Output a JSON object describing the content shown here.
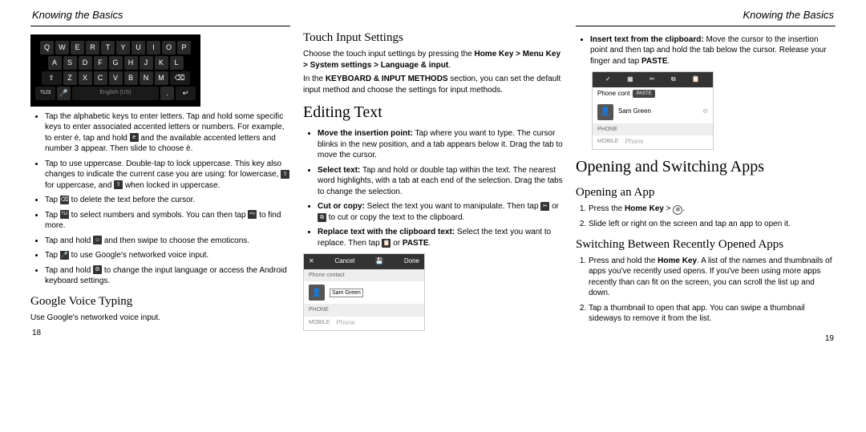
{
  "header": {
    "left": "Knowing the Basics",
    "right": "Knowing the Basics"
  },
  "footer": {
    "left": "18",
    "right": "19"
  },
  "col1": {
    "kb": {
      "r1": [
        "Q",
        "W",
        "E",
        "R",
        "T",
        "Y",
        "U",
        "I",
        "O",
        "P"
      ],
      "r2": [
        "A",
        "S",
        "D",
        "F",
        "G",
        "H",
        "J",
        "K",
        "L"
      ],
      "r3_shift": "⇧",
      "r3": [
        "Z",
        "X",
        "C",
        "V",
        "B",
        "N",
        "M"
      ],
      "r3_del": "⌫",
      "r4_num": "?123",
      "r4_mic": "🎤",
      "r4_space": "English (US)",
      "r4_dot": ".",
      "r4_ret": "↵"
    },
    "b1": "Tap the alphabetic keys to enter letters. Tap and hold some specific keys to enter associated accented letters or numbers. For example, to enter è, tap and hold ",
    "b1_icon": "e",
    "b1_tail": " and the available accented letters and number 3 appear. Then slide to choose è.",
    "b2_a": "Tap ",
    "b2_b": " to use uppercase. Double-tap ",
    "b2_c": " to lock uppercase. This key also changes to indicate the current case you are using: ",
    "b2_d": " for lowercase, ",
    "b2_e": " for uppercase, and ",
    "b2_f": " when locked in uppercase.",
    "b3_a": "Tap ",
    "b3_b": " to delete the text before the cursor.",
    "b4_a": "Tap ",
    "b4_b": " to select numbers and symbols. You can then tap ",
    "b4_c": " to find more.",
    "b5_a": "Tap and hold ",
    "b5_b": " and then swipe to choose the emoticons.",
    "b6_a": "Tap ",
    "b6_b": " to use Google's networked voice input.",
    "b7_a": "Tap and hold ",
    "b7_b": " to change the input language or access the Android keyboard settings.",
    "h_gvt": "Google Voice Typing",
    "gvt_body": "Use Google's networked voice input."
  },
  "col2": {
    "h_tis": "Touch Input Settings",
    "tis1": "Choose the touch input settings by pressing the ",
    "tis_bold": "Home Key > Menu Key > System settings > Language & input",
    "tis_dot": ".",
    "tis2_a": "In the ",
    "tis2_b": "KEYBOARD & INPUT METHODS",
    "tis2_c": " section, you can set the default input method and choose the settings for input methods.",
    "h_edit": "Editing Text",
    "e1_b": "Move the insertion point:",
    "e1": " Tap where you want to type. The cursor blinks in the new position, and a tab appears below it. Drag the tab to move the cursor.",
    "e2_b": "Select text:",
    "e2": " Tap and hold or double tap within the text. The nearest word highlights, with a tab at each end of the selection. Drag the tabs to change the selection.",
    "e3_b": "Cut or copy:",
    "e3a": " Select the text you want to manipulate. Then tap ",
    "e3b": " or ",
    "e3c": " to cut or copy the text to the clipboard.",
    "e4_b": "Replace text with the clipboard text:",
    "e4a": " Select the text you want to replace. Then tap ",
    "e4b": " or ",
    "e4_paste": "PASTE",
    "e4c": ".",
    "cc": {
      "cancel": "Cancel",
      "done": "Done",
      "title": "Phone contact",
      "name": "Sam Green",
      "phone_lbl": "PHONE",
      "mobile": "MOBILE",
      "phone_val": "Phone"
    }
  },
  "col3": {
    "e5_b": "Insert text from the clipboard:",
    "e5a": " Move the cursor to the insertion point and then tap and hold the tab below the cursor. Release your finger and tap ",
    "e5_paste": "PASTE",
    "e5b": ".",
    "cc": {
      "title": "Phone cont",
      "paste": "PASTE",
      "name": "Sam Green",
      "phone_lbl": "PHONE",
      "mobile": "MOBILE",
      "phone_val": "Phone"
    },
    "h_open": "Opening and Switching Apps",
    "h_openapp": "Opening an App",
    "oa1_a": "Press the ",
    "oa1_b": "Home Key",
    "oa1_c": " > ",
    "oa2": "Slide left or right on the screen and tap an app to open it.",
    "h_switch": "Switching Between Recently Opened Apps",
    "sw1_a": "Press and hold the ",
    "sw1_b": "Home Key",
    "sw1_c": ". A list of the names and thumbnails of apps you've recently used opens. If you've been using more apps recently than can fit on the screen, you can scroll the list up and down.",
    "sw2": "Tap a thumbnail to open that app. You can swipe a thumbnail sideways to remove it from the list."
  }
}
